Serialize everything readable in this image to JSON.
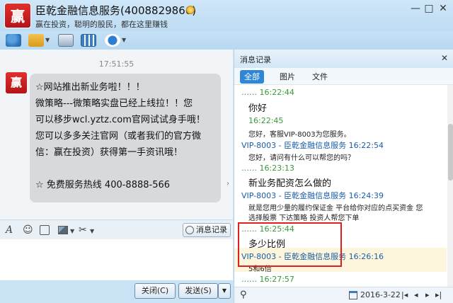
{
  "window": {
    "avatar_char": "赢",
    "title": "臣乾金融信息服务(4008829866)",
    "subtitle": "赢在投资，聪明的股民，都在这里赚钱",
    "controls": [
      "—",
      "□",
      "✕"
    ]
  },
  "chat": {
    "timestamp": "17:51:55",
    "sender_avatar_char": "赢",
    "message_lines": [
      "☆网站推出新业务啦！！！",
      "  微策略---微策略实盘已经上线拉！！您",
      "可以移步wcl.yztz.com官网试试身手哦！",
      "您可以多多关注官网（或者我们的官方微",
      "信：赢在投资）获得第一手资讯哦！",
      "",
      "☆ 免费服务热线 400-8888-566"
    ],
    "history_button_label": "消息记录",
    "close_button_label": "关闭(C)",
    "send_button_label": "发送(S)"
  },
  "history": {
    "header_title": "消息记录",
    "tabs": [
      {
        "label": "全部",
        "active": true
      },
      {
        "label": "图片",
        "active": false
      },
      {
        "label": "文件",
        "active": false
      }
    ],
    "messages": [
      {
        "kind": "time",
        "text": "…… 16:22:44"
      },
      {
        "kind": "big",
        "text": "你好"
      },
      {
        "kind": "time",
        "text": "16:22:45"
      },
      {
        "kind": "small",
        "text": "您好，客服VIP-8003为您服务。"
      },
      {
        "kind": "sender",
        "text": "VIP-8003 - 臣乾金融信息服务 16:22:54"
      },
      {
        "kind": "small",
        "text": "您好，请问有什么可以帮您的吗？"
      },
      {
        "kind": "time",
        "text": "…… 16:23:13"
      },
      {
        "kind": "big",
        "text": "新业务配资怎么做的"
      },
      {
        "kind": "sender",
        "text": "VIP-8003 - 臣乾金融信息服务 16:24:39"
      },
      {
        "kind": "small",
        "text": "就是您用少量的履约保证金  平台给你对应的点买资金  您"
      },
      {
        "kind": "small",
        "text": "选择股票 下达策略 投资人帮您下单"
      },
      {
        "kind": "time",
        "text": "…… 16:25:44"
      },
      {
        "kind": "big",
        "text": "多少比例"
      },
      {
        "kind": "sender",
        "text": "VIP-8003 - 臣乾金融信息服务 16:26:16"
      },
      {
        "kind": "small",
        "text": "5和6倍"
      },
      {
        "kind": "time",
        "text": "…… 16:27:57"
      }
    ],
    "footer_date": "2016-3-22"
  }
}
